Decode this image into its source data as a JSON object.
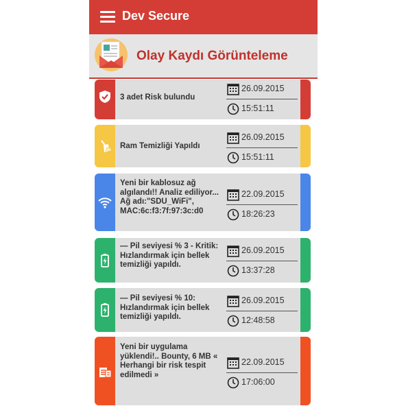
{
  "app": {
    "title": "Dev Secure"
  },
  "page": {
    "title": "Olay Kaydı Görünteleme"
  },
  "colors": {
    "red": "#d43d35",
    "yellow": "#f6c744",
    "blue": "#4a86e8",
    "green": "#2db26d",
    "orange": "#f05122"
  },
  "events": [
    {
      "message": "3 adet Risk bulundu",
      "date": "26.09.2015",
      "time": "15:51:11",
      "color": "#d43d35",
      "icon": "shield-check-icon"
    },
    {
      "message": "Ram Temizliği Yapıldı",
      "date": "26.09.2015",
      "time": "15:51:11",
      "color": "#f6c744",
      "icon": "broom-icon"
    },
    {
      "message": "Yeni bir kablosuz ağ algılandı!! Analiz ediliyor... Ağ adı:\"SDU_WiFi\", MAC:6c:f3:7f:97:3c:d0",
      "date": "22.09.2015",
      "time": "18:26:23",
      "color": "#4a86e8",
      "icon": "wifi-icon"
    },
    {
      "message": "— Pil seviyesi % 3 - Kritik: Hızlandırmak için bellek temizliği yapıldı.",
      "date": "26.09.2015",
      "time": "13:37:28",
      "color": "#2db26d",
      "icon": "battery-charging-icon"
    },
    {
      "message": "— Pil seviyesi % 10: Hızlandırmak için bellek temizliği yapıldı.",
      "date": "26.09.2015",
      "time": "12:48:58",
      "color": "#2db26d",
      "icon": "battery-charging-icon"
    },
    {
      "message": "Yeni bir uygulama yüklendi!.. Bounty, 6 MB « Herhangi bir risk tespit edilmedi »",
      "date": "22.09.2015",
      "time": "17:06:00",
      "color": "#f05122",
      "icon": "app-install-icon"
    }
  ]
}
